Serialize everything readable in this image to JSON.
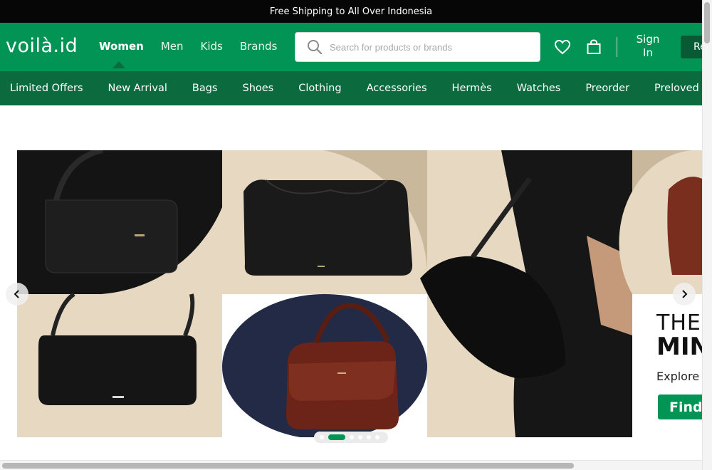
{
  "announcement": "Free Shipping to All Over Indonesia",
  "header": {
    "logo": "voilà.id",
    "nav": [
      "Women",
      "Men",
      "Kids",
      "Brands"
    ],
    "active_nav": "Women",
    "search_placeholder": "Search for products or brands",
    "sign_in_line1": "Sign",
    "sign_in_line2": "In",
    "register_label": "Re"
  },
  "categories": [
    "Limited Offers",
    "New Arrival",
    "Bags",
    "Shoes",
    "Clothing",
    "Accessories",
    "Hermès",
    "Watches",
    "Preorder",
    "Preloved"
  ],
  "hero": {
    "headline_1": "THE",
    "headline_2": "MIN",
    "subtext": "Explore",
    "cta": "Find",
    "slide_count": 6,
    "active_slide": 2
  },
  "colors": {
    "brand_green": "#019454",
    "dark_green": "#0b6b3e",
    "announcement_bg": "#060606",
    "beige": "#e7d8c2",
    "leather_brown": "#7a2e1e"
  },
  "icons": [
    "search-icon",
    "heart-icon",
    "shopping-bag-icon",
    "chevron-left-icon",
    "chevron-right-icon"
  ]
}
